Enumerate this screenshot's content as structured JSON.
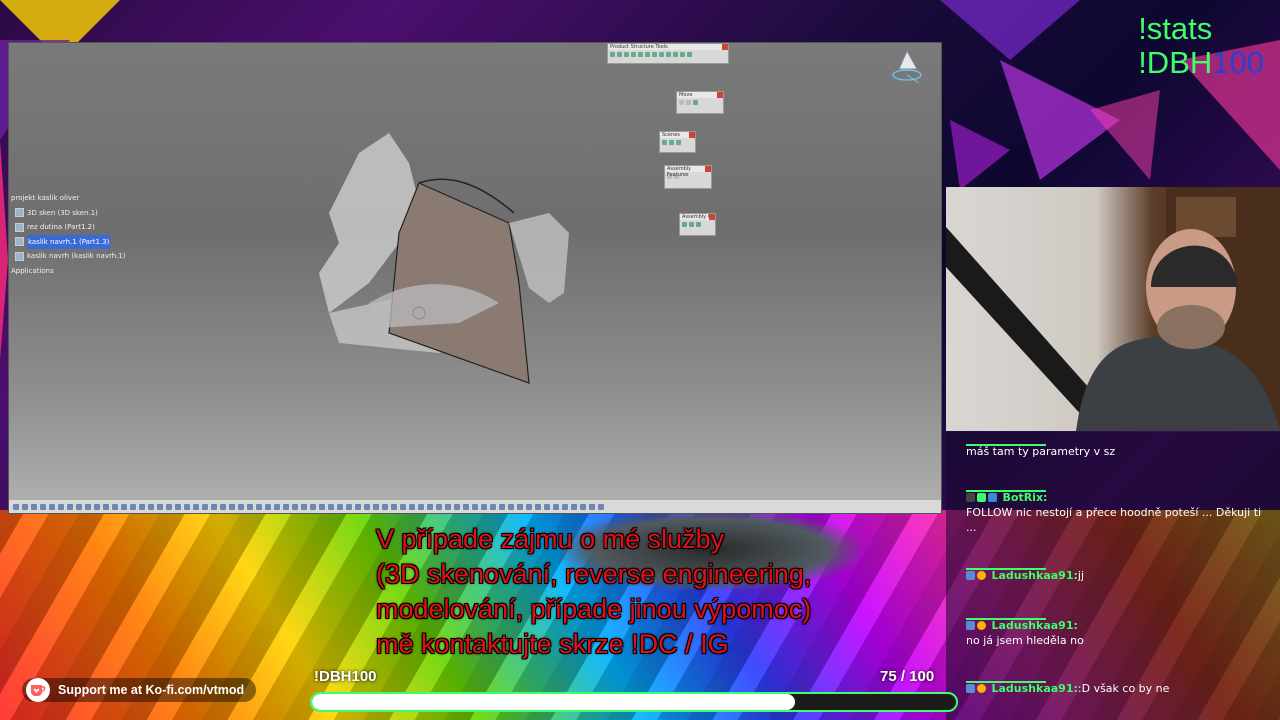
{
  "overlay": {
    "command_stats": "!stats",
    "command_dbh_prefix": "!DBH",
    "command_dbh_suffix": "100"
  },
  "cad": {
    "tree": [
      {
        "label": "projekt kaslik oliver",
        "level": 0,
        "selected": false
      },
      {
        "label": "3D sken (3D sken.1)",
        "level": 1,
        "selected": false
      },
      {
        "label": "rez dutina (Part1.2)",
        "level": 1,
        "selected": false
      },
      {
        "label": "kaslik navrh.1 (Part1.3)",
        "level": 1,
        "selected": true
      },
      {
        "label": "kaslik navrh (kaslik navrh.1)",
        "level": 1,
        "selected": false
      },
      {
        "label": "Applications",
        "level": 0,
        "selected": false
      }
    ],
    "toolbars": {
      "product_structure": "Product Structure Tools",
      "move": "Move",
      "scenes": "Scenes",
      "assembly_features": "Assembly Features",
      "assembly_c": "Assembly C"
    }
  },
  "promo": {
    "line1": "V případe zájmu o mé služby",
    "line2": "(3D skenování, reverse engineering,",
    "line3": "modelování, případe jinou výpomoc)",
    "line4": "mě kontaktujte skrze !DC / IG"
  },
  "goal": {
    "label": "!DBH100",
    "current": 75,
    "total": 100,
    "count_text": "75  / 100",
    "progress": 0.75
  },
  "kofi": {
    "text": "Support me at Ko-fi.com/vtmod"
  },
  "chat": {
    "messages": [
      {
        "user": "",
        "text": "máš tam ty parametry v sz",
        "user_color": "#3cff6a"
      },
      {
        "user": "BotRix:",
        "text": "FOLLOW nic nestojí a přece hoodně poteší ... Děkuji ti ...",
        "user_color": "#3cff6a"
      },
      {
        "user": "Ladushkaa91:",
        "text": "jj",
        "user_color": "#3cff6a"
      },
      {
        "user": "Ladushkaa91:",
        "text": "no já jsem hleděla no",
        "user_color": "#3cff6a"
      },
      {
        "user": "Ladushkaa91:",
        "text": ":D však co by ne",
        "user_color": "#3cff6a"
      }
    ]
  },
  "colors": {
    "accent_green": "#3cff6a",
    "promo_red": "#e0101a",
    "selection_blue": "#3a6ad8"
  }
}
